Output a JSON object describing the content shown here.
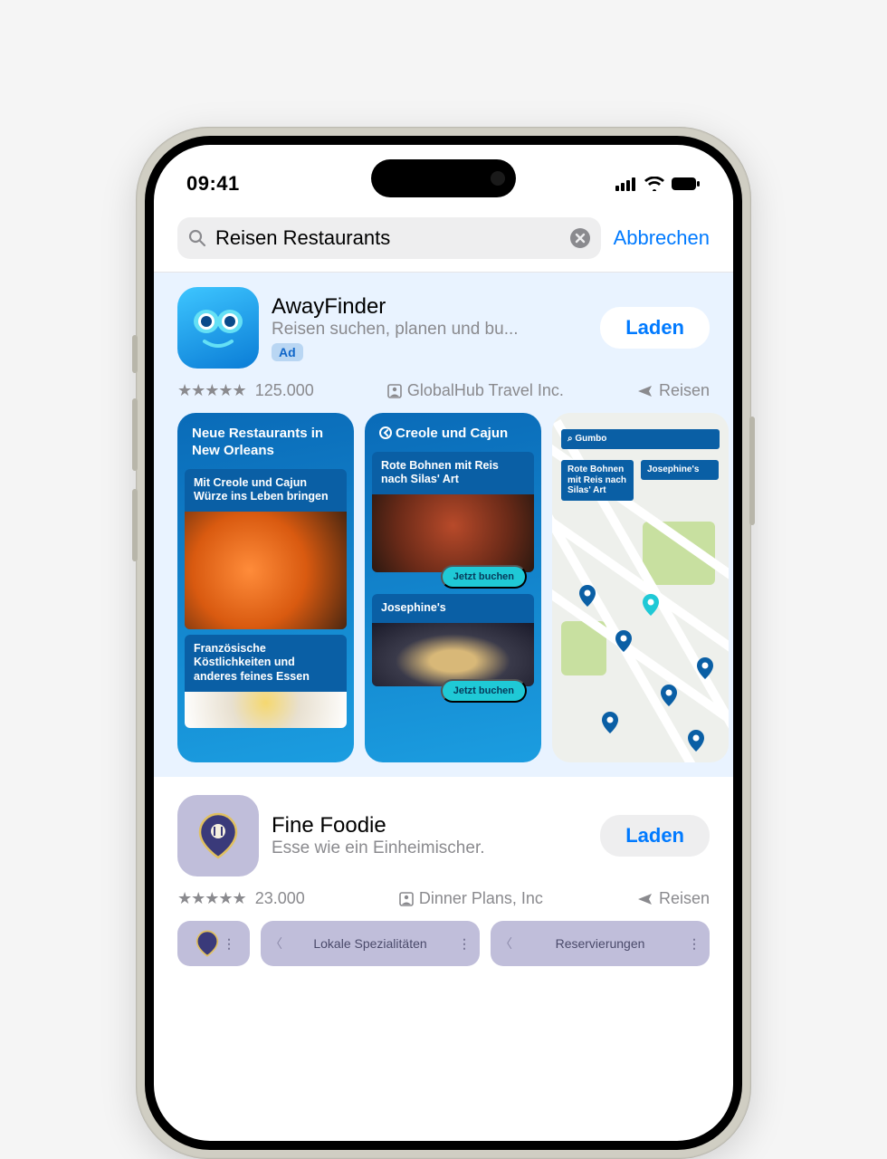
{
  "status": {
    "time": "09:41"
  },
  "search": {
    "query": "Reisen Restaurants",
    "cancel": "Abbrechen"
  },
  "ad": {
    "app_name": "AwayFinder",
    "subtitle": "Reisen suchen, planen und bu...",
    "badge": "Ad",
    "get": "Laden",
    "rating_count": "125.000",
    "developer": "GlobalHub Travel Inc.",
    "category": "Reisen",
    "shots": {
      "s1_title": "Neue Restaurants in New Orleans",
      "s1_card1": "Mit Creole und Cajun Würze ins Leben bringen",
      "s1_card2": "Französische Köstlichkeiten und anderes feines Essen",
      "s2_title": "Creole und Cajun",
      "s2_card1": "Rote Bohnen mit Reis nach Silas' Art",
      "s2_card2": "Josephine's",
      "book": "Jetzt buchen",
      "map_search": "Gumbo",
      "map_l1": "Rote Bohnen mit Reis nach Silas' Art",
      "map_l2": "Josephine's"
    }
  },
  "result2": {
    "app_name": "Fine Foodie",
    "subtitle": "Esse wie ein Einheimischer.",
    "get": "Laden",
    "rating_count": "23.000",
    "developer": "Dinner Plans, Inc",
    "category": "Reisen",
    "tab1": "Lokale Spezialitäten",
    "tab2": "Reservierungen"
  }
}
